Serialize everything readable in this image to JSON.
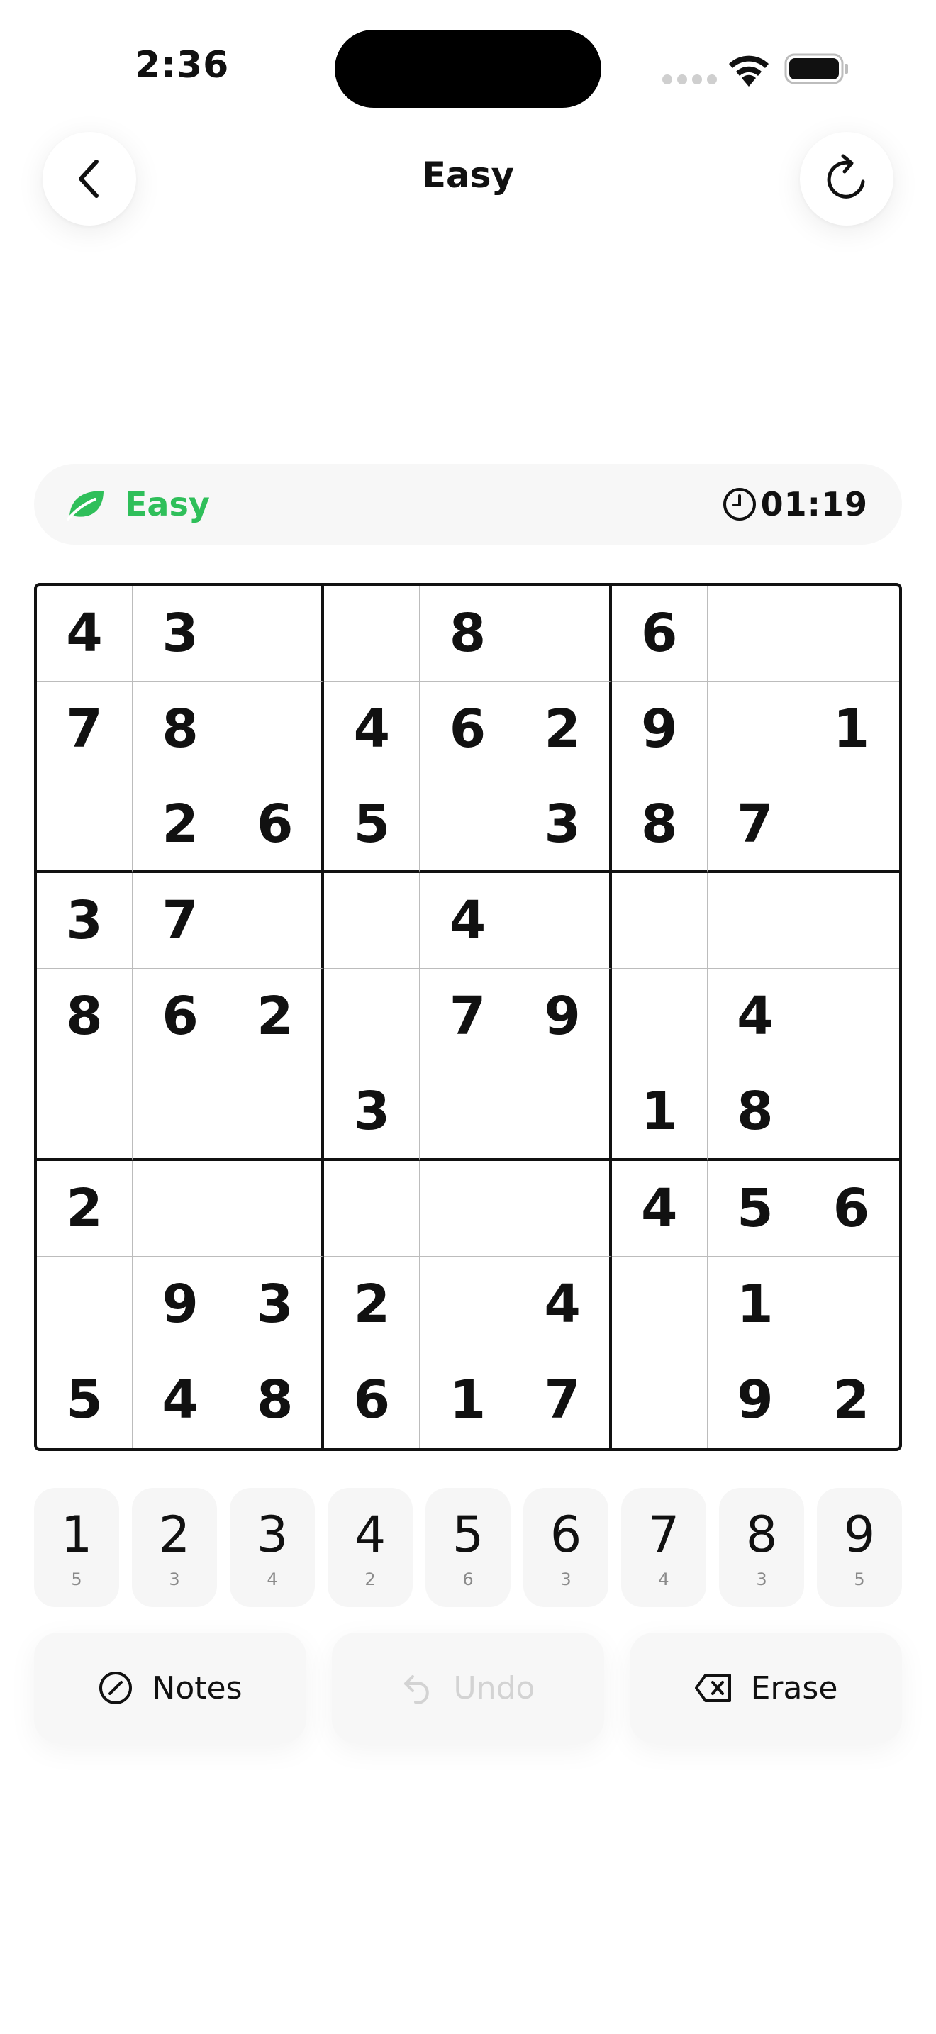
{
  "status_bar": {
    "time": "2:36"
  },
  "nav": {
    "title": "Easy"
  },
  "info": {
    "difficulty": "Easy",
    "timer": "01:19"
  },
  "colors": {
    "accent_green": "#2fbf5a",
    "text": "#111111",
    "muted": "#8a8a8a"
  },
  "icons": {
    "back": "chevron-left-icon",
    "refresh": "refresh-icon",
    "difficulty": "leaf-icon",
    "timer": "clock-icon",
    "notes": "pencil-circle-icon",
    "undo": "undo-arrow-icon",
    "erase": "backspace-icon"
  },
  "board": [
    [
      "4",
      "3",
      "",
      "",
      "8",
      "",
      "6",
      "",
      ""
    ],
    [
      "7",
      "8",
      "",
      "4",
      "6",
      "2",
      "9",
      "",
      "1"
    ],
    [
      "",
      "2",
      "6",
      "5",
      "",
      "3",
      "8",
      "7",
      ""
    ],
    [
      "3",
      "7",
      "",
      "",
      "4",
      "",
      "",
      "",
      ""
    ],
    [
      "8",
      "6",
      "2",
      "",
      "7",
      "9",
      "",
      "4",
      ""
    ],
    [
      "",
      "",
      "",
      "3",
      "",
      "",
      "1",
      "8",
      ""
    ],
    [
      "2",
      "",
      "",
      "",
      "",
      "",
      "4",
      "5",
      "6"
    ],
    [
      "",
      "9",
      "3",
      "2",
      "",
      "4",
      "",
      "1",
      ""
    ],
    [
      "5",
      "4",
      "8",
      "6",
      "1",
      "7",
      "",
      "9",
      "2"
    ]
  ],
  "numpad": [
    {
      "digit": "1",
      "count": "5"
    },
    {
      "digit": "2",
      "count": "3"
    },
    {
      "digit": "3",
      "count": "4"
    },
    {
      "digit": "4",
      "count": "2"
    },
    {
      "digit": "5",
      "count": "6"
    },
    {
      "digit": "6",
      "count": "3"
    },
    {
      "digit": "7",
      "count": "4"
    },
    {
      "digit": "8",
      "count": "3"
    },
    {
      "digit": "9",
      "count": "5"
    }
  ],
  "actions": {
    "notes": "Notes",
    "undo": "Undo",
    "erase": "Erase"
  }
}
